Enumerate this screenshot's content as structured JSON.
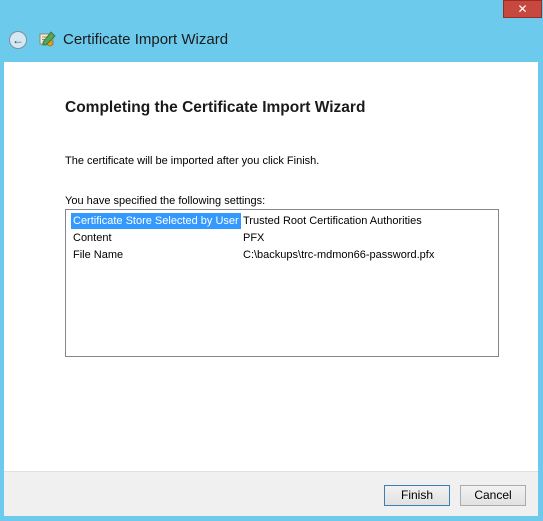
{
  "window": {
    "close_glyph": "✕",
    "title": "Certificate Import Wizard"
  },
  "nav": {
    "back_glyph": "←"
  },
  "page": {
    "heading": "Completing the Certificate Import Wizard",
    "intro": "The certificate will be imported after you click Finish.",
    "settings_label": "You have specified the following settings:"
  },
  "settings": [
    {
      "key": "Certificate Store Selected by User",
      "value": "Trusted Root Certification Authorities",
      "selected": true
    },
    {
      "key": "Content",
      "value": "PFX",
      "selected": false
    },
    {
      "key": "File Name",
      "value": "C:\\backups\\trc-mdmon66-password.pfx",
      "selected": false
    }
  ],
  "buttons": {
    "finish": "Finish",
    "cancel": "Cancel"
  },
  "colors": {
    "frame": "#6ccbed",
    "selection": "#3399ff",
    "close": "#c7483f"
  }
}
